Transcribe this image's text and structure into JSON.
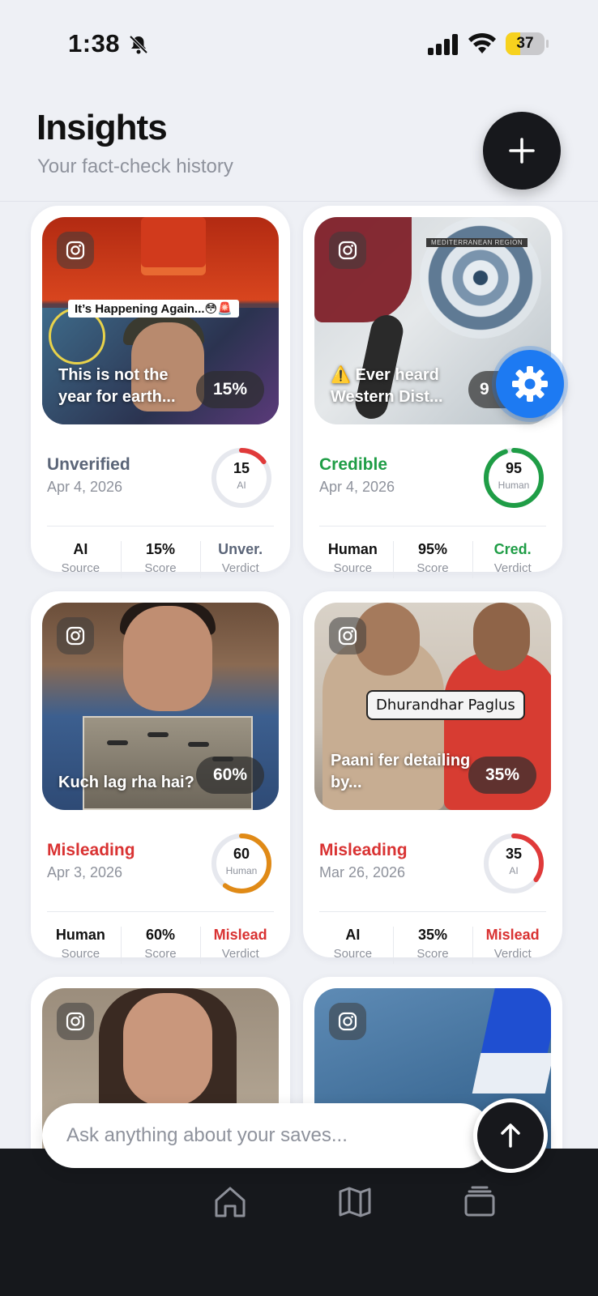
{
  "status_bar": {
    "time": "1:38",
    "battery": "37",
    "battery_level": 0.37
  },
  "header": {
    "title": "Insights",
    "subtitle": "Your fact-check history"
  },
  "cards": [
    {
      "caption": "This is not the year for earth...",
      "overlay_text": "It’s Happening Again...😳🚨",
      "percent": "15%",
      "verdict": "Unverified",
      "verdict_color": "#5b6578",
      "date": "Apr 4, 2026",
      "ring_score": "15",
      "ring_source": "AI",
      "ring_fraction": 0.15,
      "ring_color": "#e03a3a",
      "stats": [
        {
          "value": "AI",
          "label": "Source"
        },
        {
          "value": "15%",
          "label": "Score"
        },
        {
          "value": "Unver.",
          "label": "Verdict"
        }
      ]
    },
    {
      "caption": "⚠️ Ever heard Western Dist...",
      "overlay_text": "MEDITERRANEAN REGION",
      "percent": "9",
      "verdict": "Credible",
      "verdict_color": "#1f9d46",
      "date": "Apr 4, 2026",
      "ring_score": "95",
      "ring_source": "Human",
      "ring_fraction": 0.95,
      "ring_color": "#1f9d46",
      "stats": [
        {
          "value": "Human",
          "label": "Source"
        },
        {
          "value": "95%",
          "label": "Score"
        },
        {
          "value": "Cred.",
          "label": "Verdict"
        }
      ]
    },
    {
      "caption": "Kuch lag rha hai?",
      "percent": "60%",
      "verdict": "Misleading",
      "verdict_color": "#d93232",
      "date": "Apr 3, 2026",
      "ring_score": "60",
      "ring_source": "Human",
      "ring_fraction": 0.6,
      "ring_color": "#e08a16",
      "stats": [
        {
          "value": "Human",
          "label": "Source"
        },
        {
          "value": "60%",
          "label": "Score"
        },
        {
          "value": "Mislead",
          "label": "Verdict"
        }
      ]
    },
    {
      "caption": "Paani fer detailing by...",
      "overlay_text": "Dhurandhar Paglus",
      "percent": "35%",
      "verdict": "Misleading",
      "verdict_color": "#d93232",
      "date": "Mar 26, 2026",
      "ring_score": "35",
      "ring_source": "AI",
      "ring_fraction": 0.35,
      "ring_color": "#e03a3a",
      "stats": [
        {
          "value": "AI",
          "label": "Source"
        },
        {
          "value": "35%",
          "label": "Score"
        },
        {
          "value": "Mislead",
          "label": "Verdict"
        }
      ]
    }
  ],
  "ask": {
    "placeholder": "Ask anything about your saves..."
  },
  "icons": {
    "add": "plus-icon",
    "settings": "gear-icon",
    "send": "arrow-up-icon",
    "tabs": [
      "home-icon",
      "map-icon",
      "stack-icon"
    ],
    "source": "instagram-icon"
  }
}
